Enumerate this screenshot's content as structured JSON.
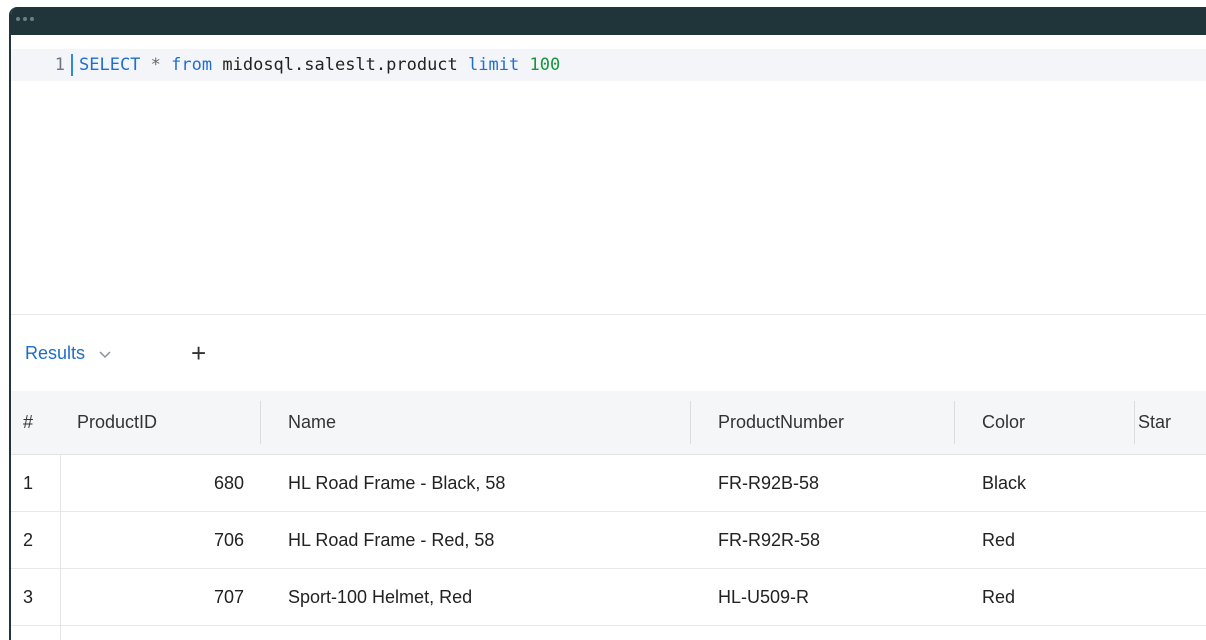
{
  "editor": {
    "line_number": "1",
    "tokens": {
      "select": "SELECT",
      "star": "*",
      "from": "from",
      "table": "midosql.saleslt.product",
      "limit": "limit",
      "limit_value": "100"
    }
  },
  "results": {
    "tab_label": "Results",
    "add_label": "+",
    "columns": [
      "#",
      "ProductID",
      "Name",
      "ProductNumber",
      "Color",
      "Star"
    ],
    "rows": [
      {
        "idx": "1",
        "product_id": "680",
        "name": "HL Road Frame - Black, 58",
        "product_number": "FR-R92B-58",
        "color": "Black"
      },
      {
        "idx": "2",
        "product_id": "706",
        "name": "HL Road Frame - Red, 58",
        "product_number": "FR-R92R-58",
        "color": "Red"
      },
      {
        "idx": "3",
        "product_id": "707",
        "name": "Sport-100 Helmet, Red",
        "product_number": "HL-U509-R",
        "color": "Red"
      }
    ]
  },
  "colors": {
    "titlebar": "#1f3539",
    "keyword": "#1f6fd0",
    "number": "#16963e",
    "tab_accent": "#1e6ec6"
  },
  "icons": [
    "window-dots-icon",
    "chevron-down-icon",
    "plus-icon"
  ]
}
